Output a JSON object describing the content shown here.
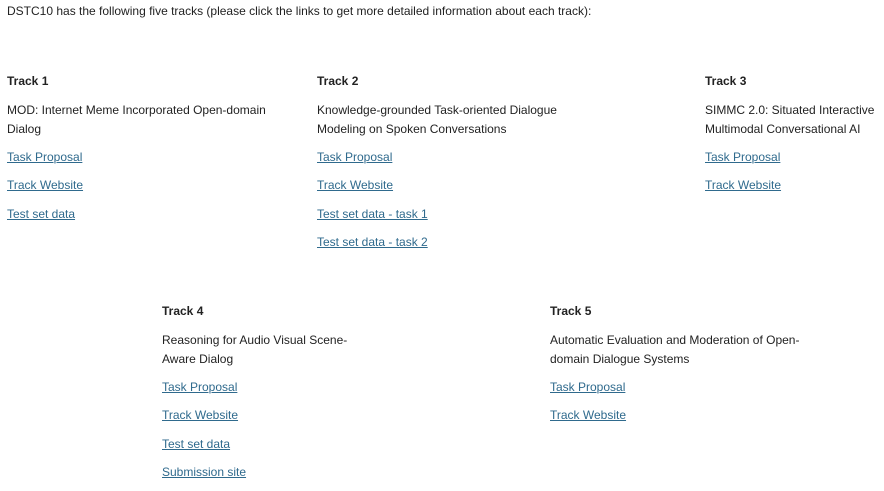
{
  "intro": "DSTC10 has the following five tracks (please click the links to get more detailed information about each track):",
  "colors": {
    "link": "#2f6a8d",
    "text": "#222222"
  },
  "tracks": [
    {
      "title": "Track 1",
      "desc": [
        "MOD: Internet Meme Incorporated Open-domain",
        "Dialog"
      ],
      "links": [
        "Task Proposal",
        "Track Website",
        "Test set data"
      ]
    },
    {
      "title": "Track 2",
      "desc": [
        "Knowledge-grounded Task-oriented Dialogue",
        "Modeling on Spoken Conversations"
      ],
      "links": [
        "Task Proposal",
        "Track Website",
        "Test set data - task 1",
        "Test set data - task 2"
      ]
    },
    {
      "title": "Track 3",
      "desc": [
        "SIMMC 2.0: Situated Interactive",
        "Multimodal Conversational AI"
      ],
      "links": [
        "Task Proposal",
        "Track Website"
      ]
    },
    {
      "title": "Track 4",
      "desc": [
        "Reasoning for Audio Visual Scene-",
        "Aware Dialog"
      ],
      "links": [
        "Task Proposal",
        "Track Website ",
        "Test set data",
        "Submission site"
      ]
    },
    {
      "title": "Track 5",
      "desc": [
        "Automatic Evaluation and Moderation of Open-",
        "domain Dialogue Systems"
      ],
      "links": [
        "Task Proposal",
        "Track Website"
      ]
    }
  ]
}
